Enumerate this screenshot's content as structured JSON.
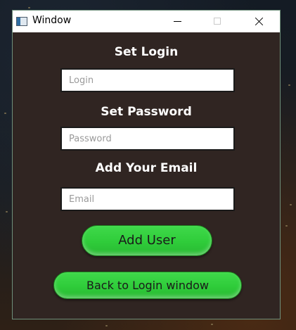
{
  "window": {
    "title": "Window"
  },
  "form": {
    "login_label": "Set Login",
    "login_placeholder": "Login",
    "password_label": "Set Password",
    "password_placeholder": "Password",
    "email_label": "Add Your Email",
    "email_placeholder": "Email",
    "add_user_label": "Add User",
    "back_label": "Back to Login window"
  },
  "colors": {
    "window_background": "#302522",
    "button_green": "#35d13f",
    "field_background": "#ffffff"
  },
  "icons": {
    "app": "app-window-icon",
    "minimize": "minimize-icon",
    "maximize": "maximize-icon",
    "close": "close-icon"
  }
}
